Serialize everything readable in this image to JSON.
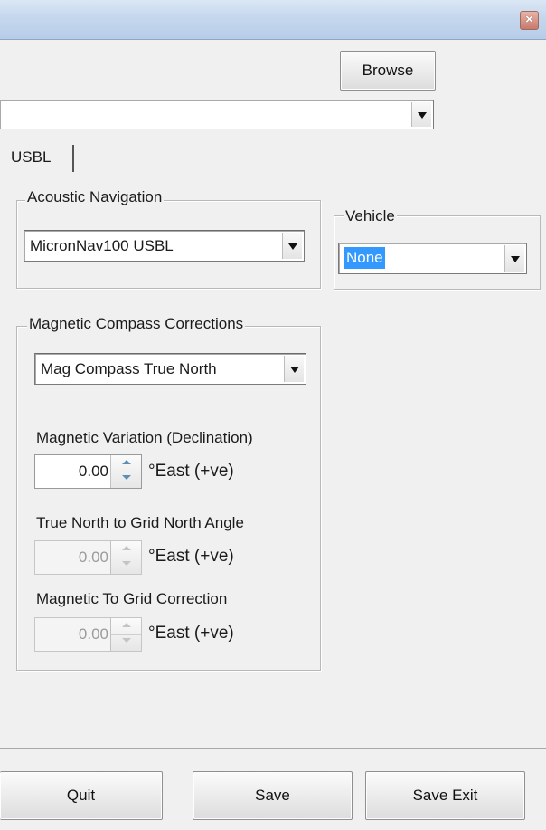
{
  "titlebar": {
    "close_glyph": "×"
  },
  "top": {
    "browse_label": "Browse",
    "path_value": ""
  },
  "tabs": {
    "active_label": "USBL"
  },
  "acoustic": {
    "title": "Acoustic Navigation",
    "selected": "MicronNav100 USBL"
  },
  "vehicle": {
    "title": "Vehicle",
    "selected": "None"
  },
  "compass": {
    "title": "Magnetic Compass Corrections",
    "selected": "Mag Compass True North",
    "variation": {
      "label": "Magnetic Variation (Declination)",
      "value": "0.00",
      "unit": "°East (+ve)"
    },
    "grid_angle": {
      "label": "True North to Grid North Angle",
      "value": "0.00",
      "unit": "°East (+ve)"
    },
    "mag_grid": {
      "label": "Magnetic To Grid Correction",
      "value": "0.00",
      "unit": "°East (+ve)"
    }
  },
  "footer": {
    "quit_label": "Quit",
    "save_label": "Save",
    "save_exit_label": "Save Exit"
  },
  "colors": {
    "titlebar": "#c5d7ed",
    "selection": "#3399ff",
    "window_bg": "#f0f0f0"
  }
}
